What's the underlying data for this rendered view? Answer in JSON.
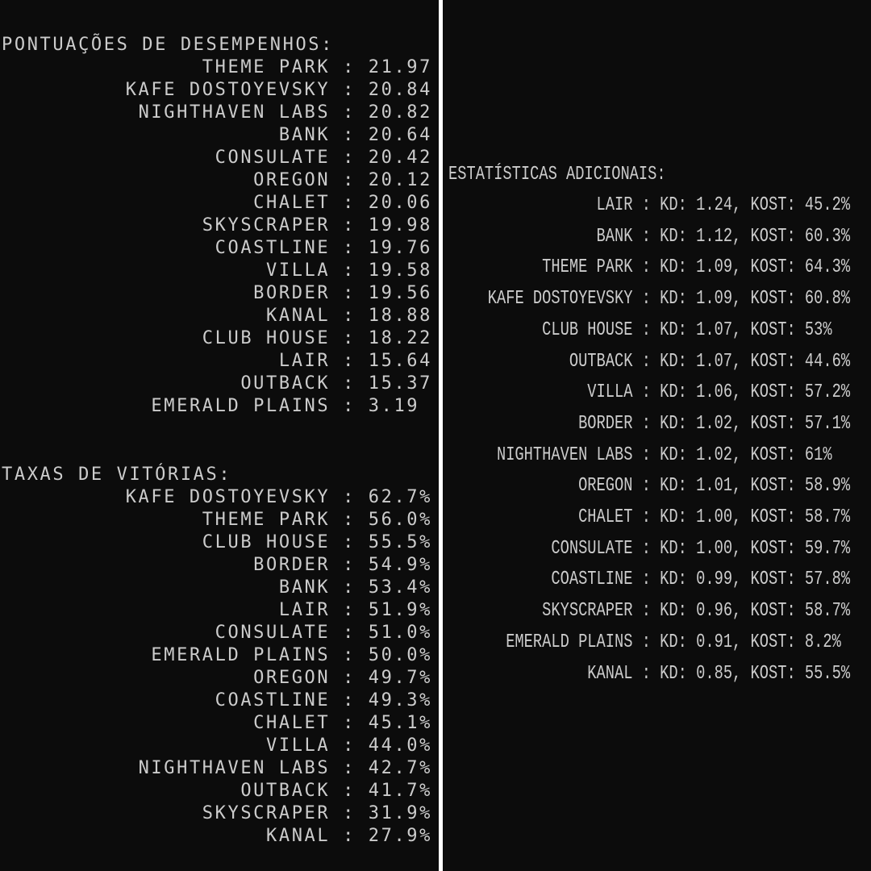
{
  "left": {
    "performance": {
      "title": "PONTUAÇÕES DE DESEMPENHOS:",
      "rows": [
        "THEME PARK : 21.97",
        "KAFE DOSTOYEVSKY : 20.84",
        "NIGHTHAVEN LABS : 20.82",
        "BANK : 20.64",
        "CONSULATE : 20.42",
        "OREGON : 20.12",
        "CHALET : 20.06",
        "SKYSCRAPER : 19.98",
        "COASTLINE : 19.76",
        "VILLA : 19.58",
        "BORDER : 19.56",
        "KANAL : 18.88",
        "CLUB HOUSE : 18.22",
        "LAIR : 15.64",
        "OUTBACK : 15.37",
        "EMERALD PLAINS : 3.19 "
      ]
    },
    "win_rates": {
      "title": "TAXAS DE VITÓRIAS:",
      "rows": [
        "KAFE DOSTOYEVSKY : 62.7%",
        "THEME PARK : 56.0%",
        "CLUB HOUSE : 55.5%",
        "BORDER : 54.9%",
        "BANK : 53.4%",
        "LAIR : 51.9%",
        "CONSULATE : 51.0%",
        "EMERALD PLAINS : 50.0%",
        "OREGON : 49.7%",
        "COASTLINE : 49.3%",
        "CHALET : 45.1%",
        "VILLA : 44.0%",
        "NIGHTHAVEN LABS : 42.7%",
        "OUTBACK : 41.7%",
        "SKYSCRAPER : 31.9%",
        "KANAL : 27.9%"
      ]
    }
  },
  "right": {
    "stats": {
      "title": "ESTATÍSTICAS ADICIONAIS:",
      "rows": [
        "LAIR : KD: 1.24, KOST: 45.2%",
        "BANK : KD: 1.12, KOST: 60.3%",
        "THEME PARK : KD: 1.09, KOST: 64.3%",
        "KAFE DOSTOYEVSKY : KD: 1.09, KOST: 60.8%",
        "CLUB HOUSE : KD: 1.07, KOST: 53%  ",
        "OUTBACK : KD: 1.07, KOST: 44.6%",
        "VILLA : KD: 1.06, KOST: 57.2%",
        "BORDER : KD: 1.02, KOST: 57.1%",
        "NIGHTHAVEN LABS : KD: 1.02, KOST: 61%  ",
        "OREGON : KD: 1.01, KOST: 58.9%",
        "CHALET : KD: 1.00, KOST: 58.7%",
        "CONSULATE : KD: 1.00, KOST: 59.7%",
        "COASTLINE : KD: 0.99, KOST: 57.8%",
        "SKYSCRAPER : KD: 0.96, KOST: 58.7%",
        "EMERALD PLAINS : KD: 0.91, KOST: 8.2% ",
        "KANAL : KD: 0.85, KOST: 55.5%"
      ]
    }
  }
}
